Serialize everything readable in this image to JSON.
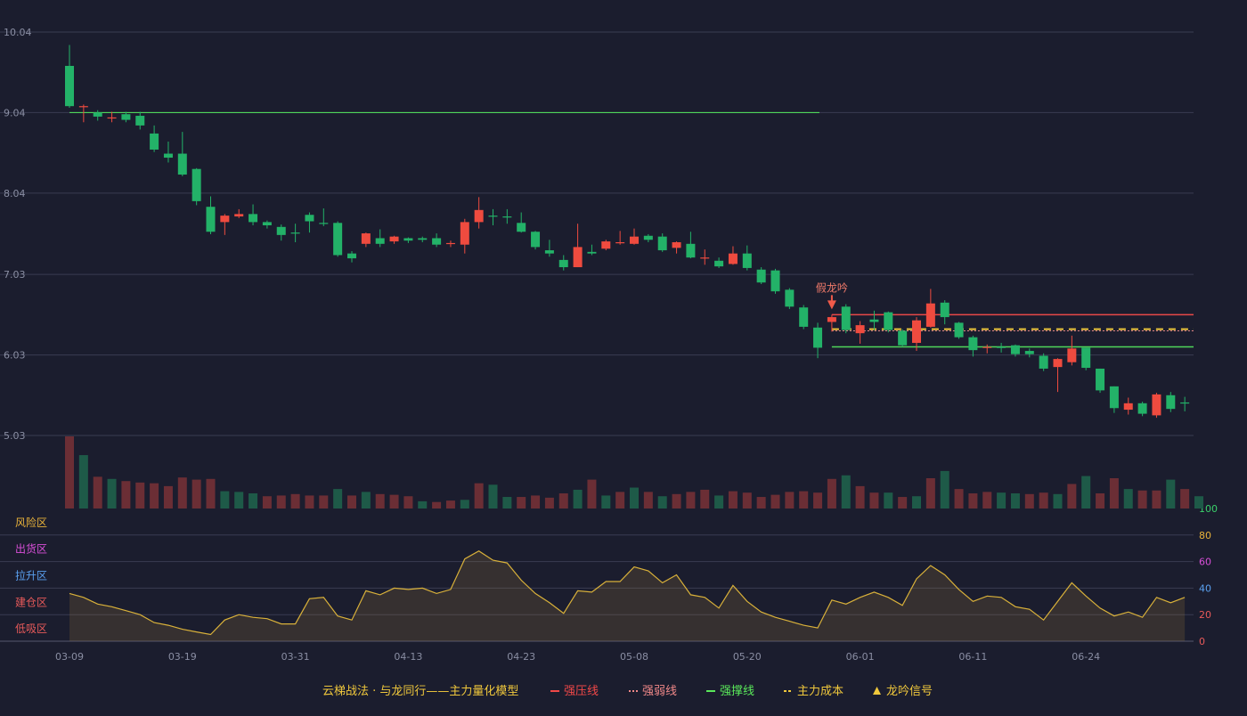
{
  "chart_data": {
    "type": "candlestick",
    "price_axis": {
      "ylim": [
        5.03,
        10.04
      ],
      "ticks": [
        10.04,
        9.04,
        8.04,
        7.03,
        6.03,
        5.03
      ]
    },
    "x_tick_labels": [
      {
        "i": 0,
        "label": "03-09"
      },
      {
        "i": 8,
        "label": "03-19"
      },
      {
        "i": 16,
        "label": "03-31"
      },
      {
        "i": 24,
        "label": "04-13"
      },
      {
        "i": 32,
        "label": "04-23"
      },
      {
        "i": 40,
        "label": "05-08"
      },
      {
        "i": 48,
        "label": "05-20"
      },
      {
        "i": 56,
        "label": "06-01"
      },
      {
        "i": 64,
        "label": "06-11"
      },
      {
        "i": 72,
        "label": "06-24"
      }
    ],
    "candles": [
      [
        9.62,
        9.12,
        9.88,
        9.1
      ],
      [
        9.12,
        9.12,
        9.14,
        8.92
      ],
      [
        9.04,
        8.99,
        9.07,
        8.94
      ],
      [
        8.98,
        8.98,
        9.05,
        8.92
      ],
      [
        9.02,
        8.95,
        9.05,
        8.92
      ],
      [
        9.0,
        8.88,
        9.05,
        8.83
      ],
      [
        8.78,
        8.58,
        8.88,
        8.55
      ],
      [
        8.53,
        8.48,
        8.68,
        8.42
      ],
      [
        8.53,
        8.27,
        8.8,
        8.25
      ],
      [
        8.34,
        7.94,
        8.35,
        7.89
      ],
      [
        7.87,
        7.56,
        8.0,
        7.53
      ],
      [
        7.68,
        7.76,
        7.78,
        7.52
      ],
      [
        7.75,
        7.78,
        7.84,
        7.73
      ],
      [
        7.78,
        7.68,
        7.9,
        7.64
      ],
      [
        7.68,
        7.64,
        7.7,
        7.6
      ],
      [
        7.62,
        7.52,
        7.65,
        7.45
      ],
      [
        7.55,
        7.55,
        7.66,
        7.43
      ],
      [
        7.77,
        7.69,
        7.8,
        7.55
      ],
      [
        7.67,
        7.67,
        7.85,
        7.63
      ],
      [
        7.67,
        7.27,
        7.69,
        7.25
      ],
      [
        7.29,
        7.23,
        7.32,
        7.18
      ],
      [
        7.41,
        7.54,
        7.55,
        7.37
      ],
      [
        7.48,
        7.41,
        7.59,
        7.37
      ],
      [
        7.44,
        7.5,
        7.51,
        7.41
      ],
      [
        7.48,
        7.45,
        7.49,
        7.42
      ],
      [
        7.48,
        7.46,
        7.5,
        7.43
      ],
      [
        7.48,
        7.4,
        7.54,
        7.37
      ],
      [
        7.42,
        7.42,
        7.45,
        7.37
      ],
      [
        7.4,
        7.68,
        7.72,
        7.29
      ],
      [
        7.68,
        7.83,
        7.99,
        7.6
      ],
      [
        7.76,
        7.76,
        7.84,
        7.64
      ],
      [
        7.75,
        7.74,
        7.84,
        7.66
      ],
      [
        7.67,
        7.56,
        7.8,
        7.55
      ],
      [
        7.56,
        7.37,
        7.57,
        7.34
      ],
      [
        7.33,
        7.29,
        7.46,
        7.25
      ],
      [
        7.21,
        7.12,
        7.27,
        7.08
      ],
      [
        7.12,
        7.37,
        7.66,
        7.12
      ],
      [
        7.31,
        7.29,
        7.4,
        7.27
      ],
      [
        7.35,
        7.44,
        7.46,
        7.33
      ],
      [
        7.43,
        7.43,
        7.57,
        7.4
      ],
      [
        7.41,
        7.5,
        7.6,
        7.4
      ],
      [
        7.51,
        7.46,
        7.53,
        7.43
      ],
      [
        7.5,
        7.33,
        7.54,
        7.31
      ],
      [
        7.36,
        7.43,
        7.44,
        7.29
      ],
      [
        7.41,
        7.24,
        7.56,
        7.23
      ],
      [
        7.23,
        7.24,
        7.34,
        7.15
      ],
      [
        7.2,
        7.13,
        7.24,
        7.11
      ],
      [
        7.16,
        7.29,
        7.38,
        7.15
      ],
      [
        7.29,
        7.11,
        7.39,
        7.08
      ],
      [
        7.09,
        6.93,
        7.12,
        6.91
      ],
      [
        7.08,
        6.82,
        7.1,
        6.79
      ],
      [
        6.84,
        6.63,
        6.86,
        6.6
      ],
      [
        6.62,
        6.38,
        6.65,
        6.35
      ],
      [
        6.37,
        6.12,
        6.43,
        5.99
      ],
      [
        6.44,
        6.5,
        6.53,
        6.32
      ],
      [
        6.63,
        6.34,
        6.66,
        6.3
      ],
      [
        6.3,
        6.4,
        6.45,
        6.17
      ],
      [
        6.47,
        6.44,
        6.58,
        6.34
      ],
      [
        6.56,
        6.34,
        6.57,
        6.31
      ],
      [
        6.33,
        6.15,
        6.35,
        6.13
      ],
      [
        6.18,
        6.46,
        6.5,
        6.08
      ],
      [
        6.38,
        6.67,
        6.85,
        6.37
      ],
      [
        6.68,
        6.5,
        6.71,
        6.41
      ],
      [
        6.43,
        6.25,
        6.44,
        6.23
      ],
      [
        6.25,
        6.09,
        6.27,
        6.01
      ],
      [
        6.13,
        6.13,
        6.16,
        6.05
      ],
      [
        6.13,
        6.13,
        6.18,
        6.06
      ],
      [
        6.15,
        6.04,
        6.16,
        6.01
      ],
      [
        6.08,
        6.04,
        6.11,
        6.0
      ],
      [
        6.02,
        5.86,
        6.05,
        5.83
      ],
      [
        5.88,
        5.98,
        5.99,
        5.57
      ],
      [
        5.94,
        6.11,
        6.27,
        5.9
      ],
      [
        6.12,
        5.87,
        6.12,
        5.84
      ],
      [
        5.86,
        5.59,
        5.86,
        5.56
      ],
      [
        5.64,
        5.37,
        5.64,
        5.31
      ],
      [
        5.35,
        5.43,
        5.5,
        5.29
      ],
      [
        5.43,
        5.3,
        5.45,
        5.27
      ],
      [
        5.28,
        5.54,
        5.56,
        5.25
      ],
      [
        5.53,
        5.36,
        5.57,
        5.32
      ],
      [
        5.44,
        5.43,
        5.51,
        5.33
      ]
    ],
    "volume": [
      100,
      74,
      44,
      41,
      38,
      36,
      35,
      31,
      43,
      40,
      41,
      24,
      23,
      21,
      17,
      18,
      20,
      18,
      18,
      27,
      18,
      23,
      20,
      19,
      17,
      10,
      9,
      11,
      12,
      35,
      33,
      16,
      16,
      18,
      15,
      21,
      26,
      40,
      18,
      23,
      29,
      23,
      17,
      20,
      23,
      26,
      18,
      24,
      22,
      16,
      19,
      23,
      24,
      22,
      41,
      46,
      31,
      22,
      22,
      16,
      17,
      42,
      52,
      27,
      21,
      23,
      22,
      21,
      20,
      22,
      20,
      34,
      45,
      21,
      42,
      27,
      25,
      25,
      40,
      27,
      17
    ],
    "volume_up": [
      true,
      false,
      true,
      false,
      true,
      true,
      true,
      true,
      true,
      true,
      true,
      false,
      false,
      false,
      true,
      true,
      true,
      true,
      true,
      false,
      true,
      false,
      true,
      true,
      true,
      false,
      true,
      true,
      false,
      true,
      false,
      false,
      true,
      true,
      true,
      true,
      false,
      true,
      false,
      true,
      false,
      true,
      false,
      true,
      true,
      true,
      false,
      true,
      true,
      true,
      true,
      true,
      true,
      true,
      true,
      false,
      true,
      true,
      false,
      true,
      false,
      true,
      false,
      true,
      true,
      true,
      false,
      false,
      true,
      true,
      false,
      true,
      false,
      true,
      true,
      false,
      true,
      true,
      false,
      true,
      false
    ],
    "indicator": {
      "ylim": [
        0,
        100
      ],
      "ticks": [
        0,
        20,
        40,
        60,
        80,
        100
      ],
      "tick_colors": [
        "#e85a5a",
        "#e85a5a",
        "#5aa0f0",
        "#d84fd8",
        "#e8b23a",
        "#3ad06a"
      ],
      "values": [
        36,
        33,
        28,
        26,
        23,
        20,
        14,
        12,
        9,
        7,
        5,
        16,
        20,
        18,
        17,
        13,
        13,
        32,
        33,
        19,
        16,
        38,
        35,
        40,
        39,
        40,
        36,
        39,
        62,
        68,
        61,
        59,
        46,
        36,
        29,
        21,
        38,
        37,
        45,
        45,
        56,
        53,
        44,
        50,
        35,
        33,
        25,
        42,
        30,
        22,
        18,
        15,
        12,
        10,
        31,
        28,
        33,
        37,
        33,
        27,
        47,
        57,
        50,
        39,
        30,
        34,
        33,
        26,
        24,
        16,
        30,
        44,
        34,
        25,
        19,
        22,
        18,
        33,
        29,
        33
      ]
    },
    "zones": [
      "风险区",
      "出货区",
      "拉升区",
      "建仓区",
      "低吸区"
    ],
    "zone_colors": [
      "#e8b23a",
      "#d84fd8",
      "#5aa0f0",
      "#e85a5a",
      "#e85a5a"
    ],
    "lines": {
      "strong_support_early": {
        "value": 9.04,
        "from": 0,
        "to": 53
      },
      "strong_pressure": {
        "value": 6.53,
        "from": 54,
        "to": 80
      },
      "weak_line": {
        "value": 6.33,
        "from": 54,
        "to": 80
      },
      "main_cost": {
        "value": 6.35,
        "from": 54,
        "to": 80
      },
      "strong_support": {
        "value": 6.13,
        "from": 54,
        "to": 80
      }
    },
    "signal": {
      "index": 54,
      "label": "假龙吟"
    },
    "legend": {
      "title": "云梯战法 · 与龙同行——主力量化模型",
      "items": [
        {
          "label": "强压线",
          "color": "#f04848",
          "style": "solid"
        },
        {
          "label": "强弱线",
          "color": "#f08888",
          "style": "dotted"
        },
        {
          "label": "强撑线",
          "color": "#5ae85a",
          "style": "solid"
        },
        {
          "label": "主力成本",
          "color": "#f0c83c",
          "style": "dashed"
        },
        {
          "label": "龙吟信号",
          "color": "#f0c83c",
          "style": "triangle"
        }
      ]
    },
    "colors": {
      "up": "#ef4b3f",
      "down": "#23b268",
      "vol_up": "#6b2e35",
      "vol_down": "#1e5a48",
      "grid": "#3a3d52",
      "axis_text": "#8a8ea3",
      "indicator_line": "#d9b13a"
    }
  }
}
